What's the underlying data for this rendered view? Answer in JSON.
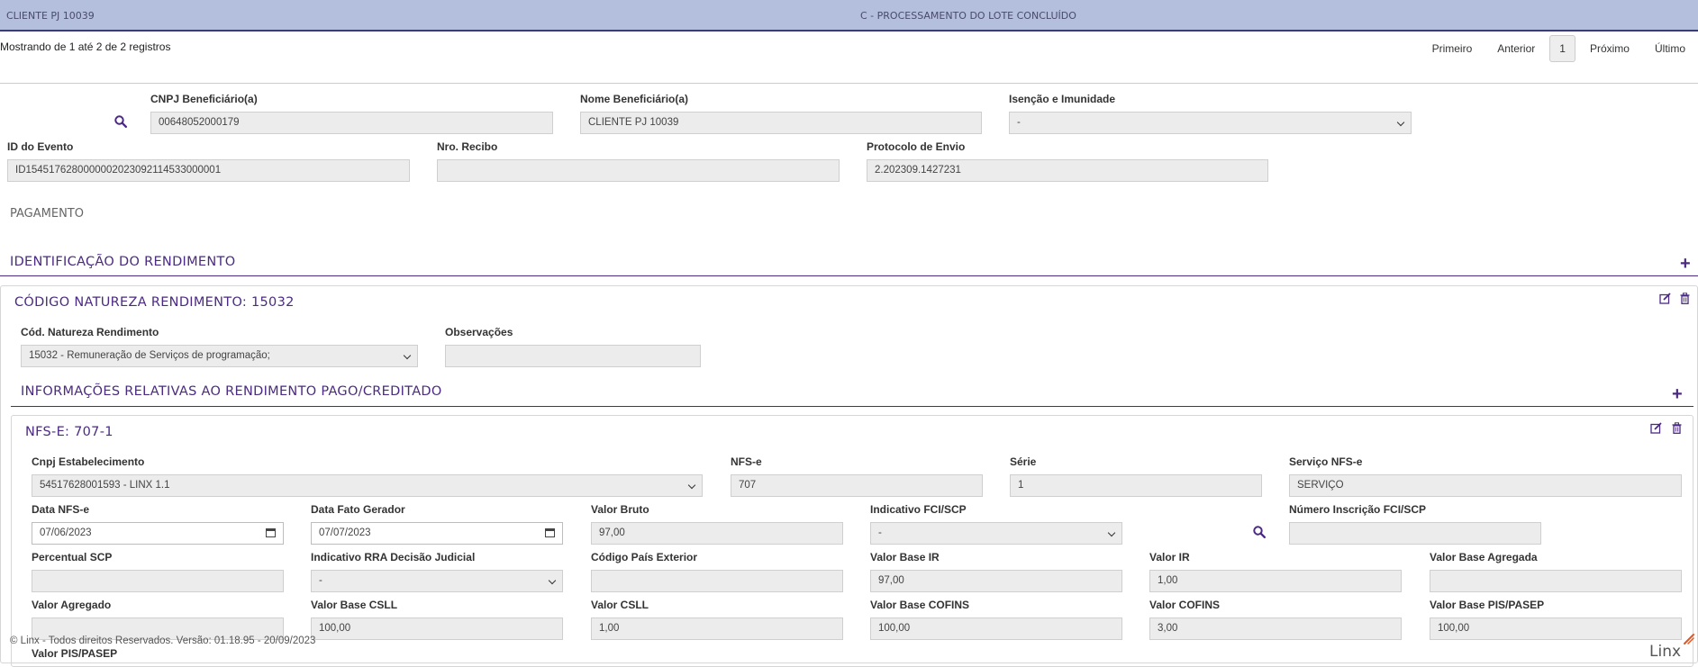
{
  "header": {
    "client": "CLIENTE PJ 10039",
    "status": "C - PROCESSAMENTO DO LOTE CONCLUÍDO"
  },
  "pagination": {
    "info": "Mostrando de 1 até 2 de 2 registros",
    "first": "Primeiro",
    "prev": "Anterior",
    "current": "1",
    "next": "Próximo",
    "last": "Último"
  },
  "beneficiario": {
    "cnpj_label": "CNPJ Beneficiário(a)",
    "cnpj_value": "00648052000179",
    "nome_label": "Nome Beneficiário(a)",
    "nome_value": "CLIENTE PJ 10039",
    "isencao_label": "Isenção e Imunidade",
    "isencao_value": "-",
    "id_evento_label": "ID do Evento",
    "id_evento_value": "ID1545176280000002023092114533000001",
    "recibo_label": "Nro. Recibo",
    "recibo_value": "",
    "protocolo_label": "Protocolo de Envio",
    "protocolo_value": "2.202309.1427231"
  },
  "pagamento_label": "PAGAMENTO",
  "identificacao": {
    "title": "IDENTIFICAÇÃO DO RENDIMENTO"
  },
  "natureza": {
    "title": "CÓDIGO NATUREZA RENDIMENTO: 15032",
    "cod_label": "Cód. Natureza Rendimento",
    "cod_value": "15032 - Remuneração de Serviços de programação;",
    "obs_label": "Observações",
    "obs_value": ""
  },
  "informacoes": {
    "title": "INFORMAÇÕES RELATIVAS AO RENDIMENTO PAGO/CREDITADO"
  },
  "nfse": {
    "title": "NFS-E: 707-1",
    "fields": {
      "cnpj_estab": {
        "label": "Cnpj Estabelecimento",
        "value": "54517628001593 - LINX 1.1"
      },
      "nfse": {
        "label": "NFS-e",
        "value": "707"
      },
      "serie": {
        "label": "Série",
        "value": "1"
      },
      "servico": {
        "label": "Serviço NFS-e",
        "value": "SERVIÇO"
      },
      "data_nfse": {
        "label": "Data NFS-e",
        "value": "07/06/2023"
      },
      "data_fato": {
        "label": "Data Fato Gerador",
        "value": "07/07/2023"
      },
      "valor_bruto": {
        "label": "Valor Bruto",
        "value": "97,00"
      },
      "indicativo_fci": {
        "label": "Indicativo FCI/SCP",
        "value": "-"
      },
      "num_fci": {
        "label": "Número Inscrição FCI/SCP",
        "value": ""
      },
      "perc_scp": {
        "label": "Percentual SCP",
        "value": ""
      },
      "rra": {
        "label": "Indicativo RRA Decisão Judicial",
        "value": "-"
      },
      "pais": {
        "label": "Código País Exterior",
        "value": ""
      },
      "base_ir": {
        "label": "Valor Base IR",
        "value": "97,00"
      },
      "valor_ir": {
        "label": "Valor IR",
        "value": "1,00"
      },
      "base_agregada": {
        "label": "Valor Base Agregada",
        "value": ""
      },
      "valor_agregado": {
        "label": "Valor Agregado",
        "value": ""
      },
      "base_csll": {
        "label": "Valor Base CSLL",
        "value": "100,00"
      },
      "valor_csll": {
        "label": "Valor CSLL",
        "value": "1,00"
      },
      "base_cofins": {
        "label": "Valor Base COFINS",
        "value": "100,00"
      },
      "valor_cofins": {
        "label": "Valor COFINS",
        "value": "3,00"
      },
      "base_pis": {
        "label": "Valor Base PIS/PASEP",
        "value": "100,00"
      },
      "valor_pis": {
        "label": "Valor PIS/PASEP",
        "value": ""
      }
    }
  },
  "footer": {
    "text": "© Linx - Todos direitos Reservados. Versão: 01.18.95 - 20/09/2023",
    "logo": "Linx"
  },
  "colors": {
    "topbar": "#b4bfde",
    "accent": "#4b2a82"
  }
}
